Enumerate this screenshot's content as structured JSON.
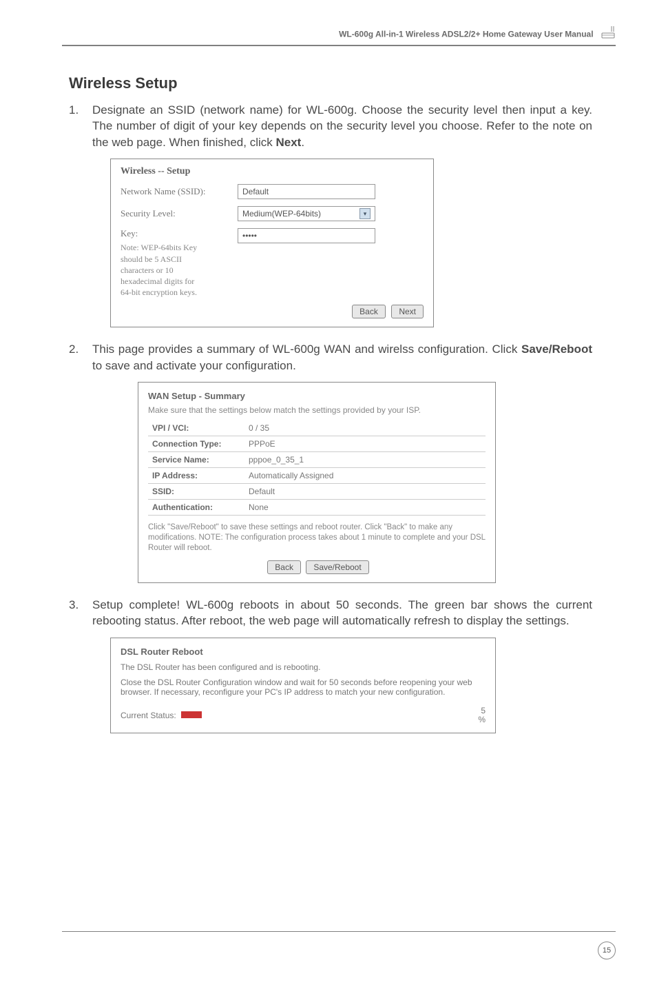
{
  "header": {
    "title": "WL-600g All-in-1 Wireless ADSL2/2+ Home Gateway User Manual"
  },
  "section_title": "Wireless Setup",
  "steps": [
    {
      "num": "1.",
      "text_a": "Designate an SSID (network name) for WL-600g. Choose the security level then input a key. The number of digit of your key depends on the security level you choose. Refer to the note on the web page. When finished, click ",
      "bold": "Next",
      "text_b": "."
    },
    {
      "num": "2.",
      "text_a": "This page provides a summary of WL-600g WAN and wirelss configuration. Click ",
      "bold": "Save/Reboot",
      "text_b": " to save and activate your configuration."
    },
    {
      "num": "3.",
      "text_a": "Setup complete! WL-600g reboots in about 50 seconds. The green bar shows the current rebooting status. After reboot, the web page will automatically refresh to display the settings.",
      "bold": "",
      "text_b": ""
    }
  ],
  "shot1": {
    "title": "Wireless -- Setup",
    "network_label": "Network Name (SSID):",
    "network_value": "Default",
    "security_label": "Security Level:",
    "security_value": "Medium(WEP-64bits)",
    "key_label": "Key:",
    "key_value": "•••••",
    "note": "Note: WEP-64bits Key should be 5 ASCII characters or 10 hexadecimal digits for 64-bit encryption keys.",
    "back": "Back",
    "next": "Next"
  },
  "shot2": {
    "title": "WAN Setup - Summary",
    "intro": "Make sure that the settings below match the settings provided by your ISP.",
    "rows": [
      {
        "k": "VPI / VCI:",
        "v": "0 / 35"
      },
      {
        "k": "Connection Type:",
        "v": "PPPoE"
      },
      {
        "k": "Service Name:",
        "v": "pppoe_0_35_1"
      },
      {
        "k": "IP Address:",
        "v": "Automatically Assigned"
      },
      {
        "k": "SSID:",
        "v": "Default"
      },
      {
        "k": "Authentication:",
        "v": "None"
      }
    ],
    "note": "Click \"Save/Reboot\" to save these settings and reboot router. Click \"Back\" to make any modifications.\nNOTE: The configuration process takes about 1 minute to complete and your DSL Router will reboot.",
    "back": "Back",
    "save": "Save/Reboot"
  },
  "shot3": {
    "title": "DSL Router Reboot",
    "line1": "The DSL Router has been configured and is rebooting.",
    "line2": "Close the DSL Router Configuration window and wait for 50 seconds before reopening your web browser. If necessary, reconfigure your PC's IP address to match your new configuration.",
    "status_label": "Current Status:",
    "pct_top": "5",
    "pct_bot": "%"
  },
  "page_number": "15"
}
